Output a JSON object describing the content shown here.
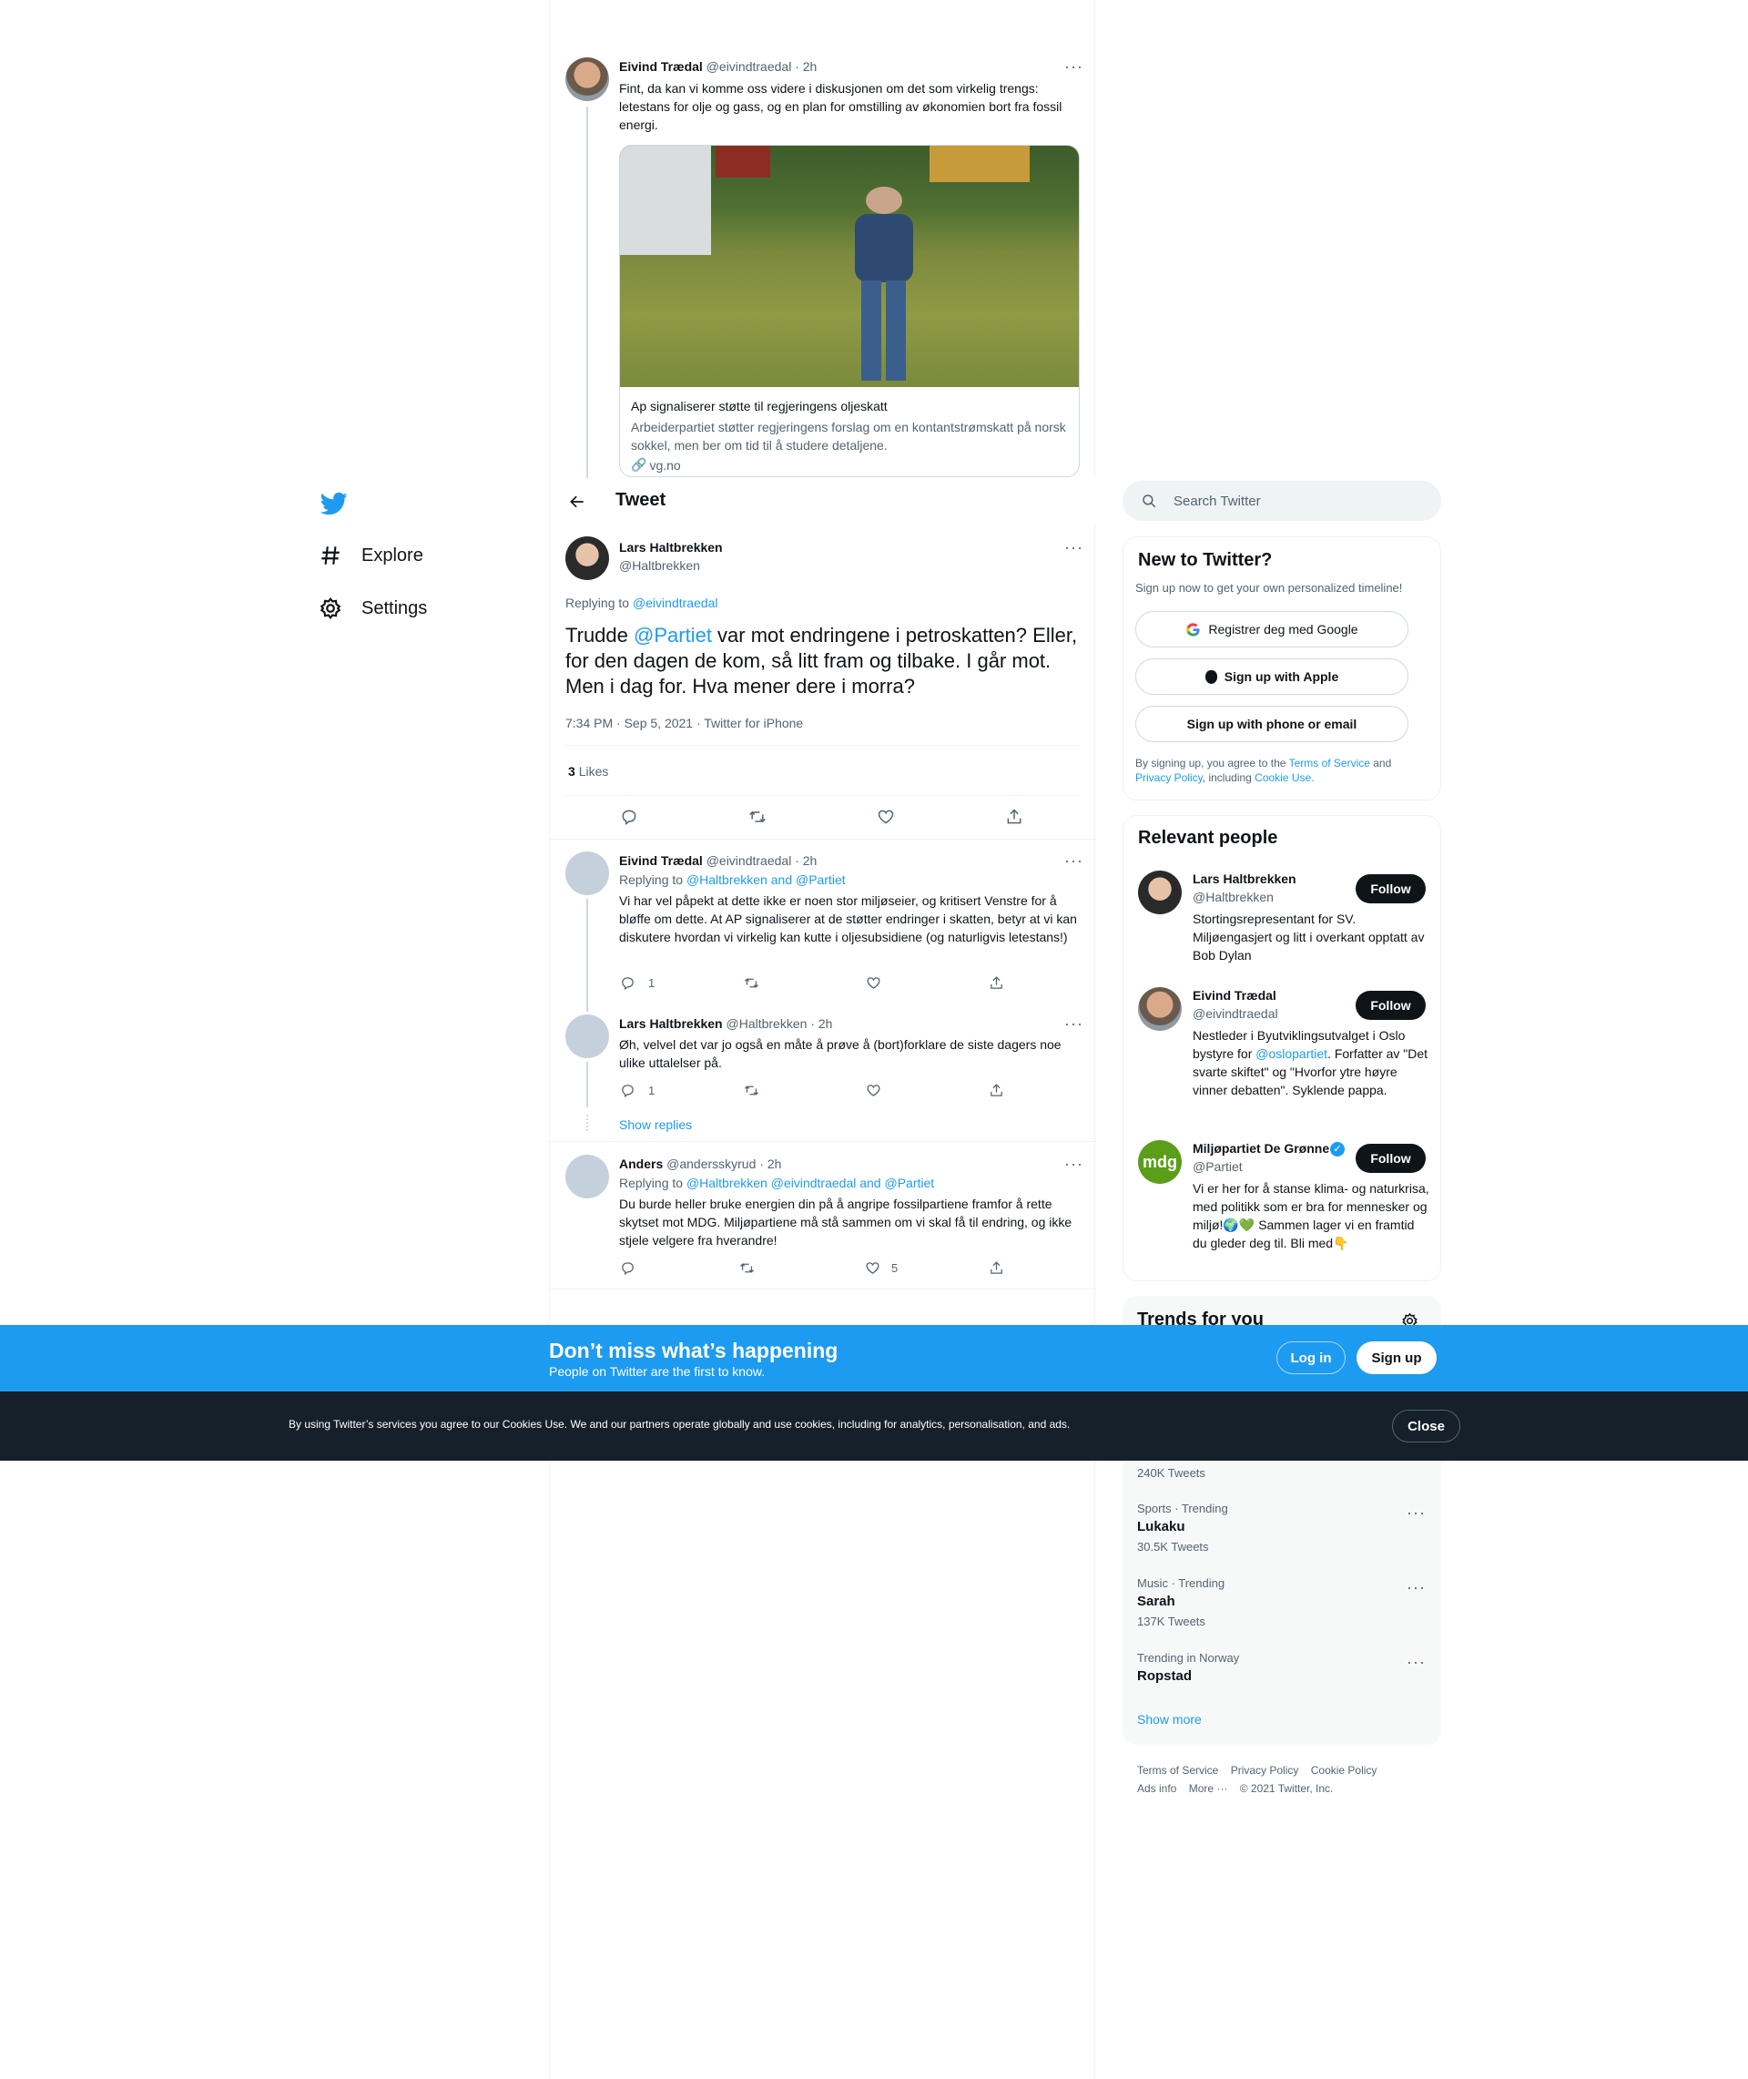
{
  "nav": {
    "items": [
      {
        "label": "Explore",
        "icon": "hashtag-icon"
      },
      {
        "label": "Settings",
        "icon": "gear-icon"
      }
    ]
  },
  "header": {
    "title": "Tweet"
  },
  "parent_tweet": {
    "name": "Eivind Trædal",
    "handle": "@eivindtraedal",
    "time": "· 2h",
    "text": "Fint, da kan vi komme oss videre i diskusjonen om det som virkelig trengs: letestans for olje og gass, og en plan for omstilling av økonomien bort fra fossil energi.",
    "card": {
      "title": "Ap signaliserer støtte til regjeringens oljeskatt",
      "description": "Arbeiderpartiet støtter regjeringens forslag om en kontantstrømskatt på norsk sokkel, men ber om tid til å studere detaljene.",
      "domain": "vg.no"
    }
  },
  "main_tweet": {
    "name": "Lars Haltbrekken",
    "handle": "@Haltbrekken",
    "replying_prefix": "Replying to ",
    "replying_to": "@eivindtraedal",
    "text_before": "Trudde ",
    "mention": "@Partiet",
    "text_after": " var mot endringene i petroskatten? Eller, for den dagen de kom, så litt fram og tilbake. I går mot. Men i dag for. Hva mener dere i morra?",
    "meta": "7:34 PM · Sep 5, 2021 · Twitter for iPhone",
    "likes_count": "3",
    "likes_label": "Likes"
  },
  "replies": [
    {
      "name": "Eivind Trædal",
      "handle": "@eivindtraedal",
      "time": "· 2h",
      "replying_prefix": "Replying to ",
      "replying_to": "@Haltbrekken and @Partiet",
      "text": "Vi har vel påpekt at dette ikke er noen stor miljøseier, og kritisert Venstre for å bløffe om dette. At AP signaliserer at de støtter endringer i skatten, betyr at vi kan diskutere hvordan vi virkelig kan kutte i oljesubsidiene (og naturligvis letestans!)",
      "reply_count": "1"
    },
    {
      "name": "Lars Haltbrekken",
      "handle": "@Haltbrekken",
      "time": "· 2h",
      "text": "Øh, velvel det var jo også en måte å prøve å (bort)forklare de siste dagers noe ulike uttalelser på.",
      "reply_count": "1"
    },
    {
      "name": "Anders",
      "handle": "@andersskyrud",
      "time": "· 2h",
      "replying_prefix": "Replying to ",
      "replying_to": "@Haltbrekken @eivindtraedal and @Partiet",
      "text": "Du burde heller bruke energien din på å angripe fossilpartiene framfor å rette skytset mot MDG. Miljøpartiene må stå sammen om vi skal få til endring, og ikke stjele velgere fra hverandre!",
      "like_count": "5"
    }
  ],
  "show_replies": "Show replies",
  "search": {
    "placeholder": "Search Twitter"
  },
  "new_to_twitter": {
    "title": "New to Twitter?",
    "subtitle": "Sign up now to get your own personalized timeline!",
    "google": "Registrer deg med Google",
    "apple": "Sign up with Apple",
    "phone": "Sign up with phone or email",
    "legal_1": "By signing up, you agree to the ",
    "terms": "Terms of Service",
    "legal_2": " and ",
    "privacy": "Privacy Policy",
    "legal_3": ", including ",
    "cookie": "Cookie Use."
  },
  "relevant_people": {
    "title": "Relevant people",
    "people": [
      {
        "name": "Lars Haltbrekken",
        "handle": "@Haltbrekken",
        "follow": "Follow",
        "bio": "Stortingsrepresentant for SV. Miljøengasjert og litt i overkant opptatt av Bob Dylan"
      },
      {
        "name": "Eivind Trædal",
        "handle": "@eivindtraedal",
        "follow": "Follow",
        "bio_before": "Nestleder i Byutviklingsutvalget i Oslo bystyre for ",
        "bio_mention": "@oslopartiet",
        "bio_after": ". Forfatter av \"Det svarte skiftet\" og \"Hvorfor ytre høyre vinner debatten\". Syklende pappa."
      },
      {
        "name": "Miljøpartiet De Grønne",
        "handle": "@Partiet",
        "follow": "Follow",
        "avatar_text": "mdg",
        "bio": "Vi er her for å stanse klima- og naturkrisa, med politikk som er bra for mennesker og miljø!🌍💚 Sammen lager vi en framtid du gleder deg til. Bli med👇"
      }
    ]
  },
  "trends": {
    "title": "Trends for you",
    "first_count": "240K Tweets",
    "items": [
      {
        "meta": "Sports · Trending",
        "name": "Lukaku",
        "count": "30.5K Tweets"
      },
      {
        "meta": "Music · Trending",
        "name": "Sarah",
        "count": "137K Tweets"
      },
      {
        "meta": "Trending in Norway",
        "name": "Ropstad",
        "count": ""
      }
    ],
    "show_more": "Show more"
  },
  "footer": {
    "links": [
      "Terms of Service",
      "Privacy Policy",
      "Cookie Policy",
      "Ads info",
      "More ···",
      "© 2021 Twitter, Inc."
    ]
  },
  "promo": {
    "title": "Don’t miss what’s happening",
    "subtitle": "People on Twitter are the first to know.",
    "login": "Log in",
    "signup": "Sign up"
  },
  "cookie_bar": {
    "text": "By using Twitter’s services you agree to our Cookies Use. We and our partners operate globally and use cookies, including for analytics, personalisation, and ads.",
    "close": "Close"
  },
  "colors": {
    "accent": "#1d9bf0",
    "dark": "#0f1419",
    "cookie_bg": "#15202b",
    "mdg_green": "#5a9e1a"
  }
}
